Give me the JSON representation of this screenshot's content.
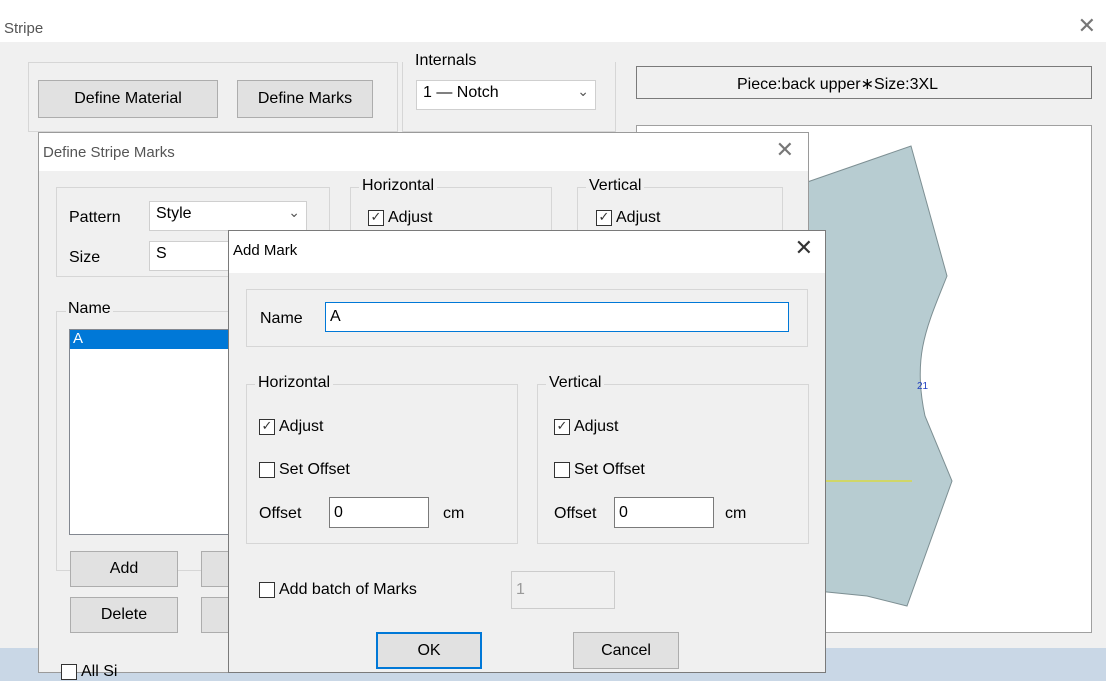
{
  "stripe": {
    "title": "Stripe",
    "define_material": "Define Material",
    "define_marks": "Define Marks",
    "internals_label": "Internals",
    "internals_value": "1 — Notch",
    "piece_info": "Piece:back upper∗Size:3XL",
    "mark_label": "21"
  },
  "define_stripe": {
    "title": "Define Stripe Marks",
    "pattern_label": "Pattern",
    "pattern_value": "Style",
    "size_label": "Size",
    "size_value": "S",
    "horizontal": "Horizontal",
    "vertical": "Vertical",
    "adjust": "Adjust",
    "name_label": "Name",
    "list_items": [
      "A"
    ],
    "add": "Add",
    "delete": "Delete",
    "all_sizes_partial": "All Si"
  },
  "add_mark": {
    "title": "Add Mark",
    "name_label": "Name",
    "name_value": "A",
    "horizontal": "Horizontal",
    "vertical": "Vertical",
    "adjust": "Adjust",
    "set_offset": "Set Offset",
    "offset_label": "Offset",
    "offset_h": "0",
    "offset_v": "0",
    "unit": "cm",
    "add_batch": "Add batch of Marks",
    "batch_value": "1",
    "ok": "OK",
    "cancel": "Cancel"
  },
  "colors": {
    "piece_fill": "#b7ccd1",
    "accent": "#0078d7",
    "taskbar": "#c9d7e6"
  },
  "icons": {
    "close": "close-icon",
    "caret": "chevron-down-icon",
    "check": "check-icon"
  }
}
